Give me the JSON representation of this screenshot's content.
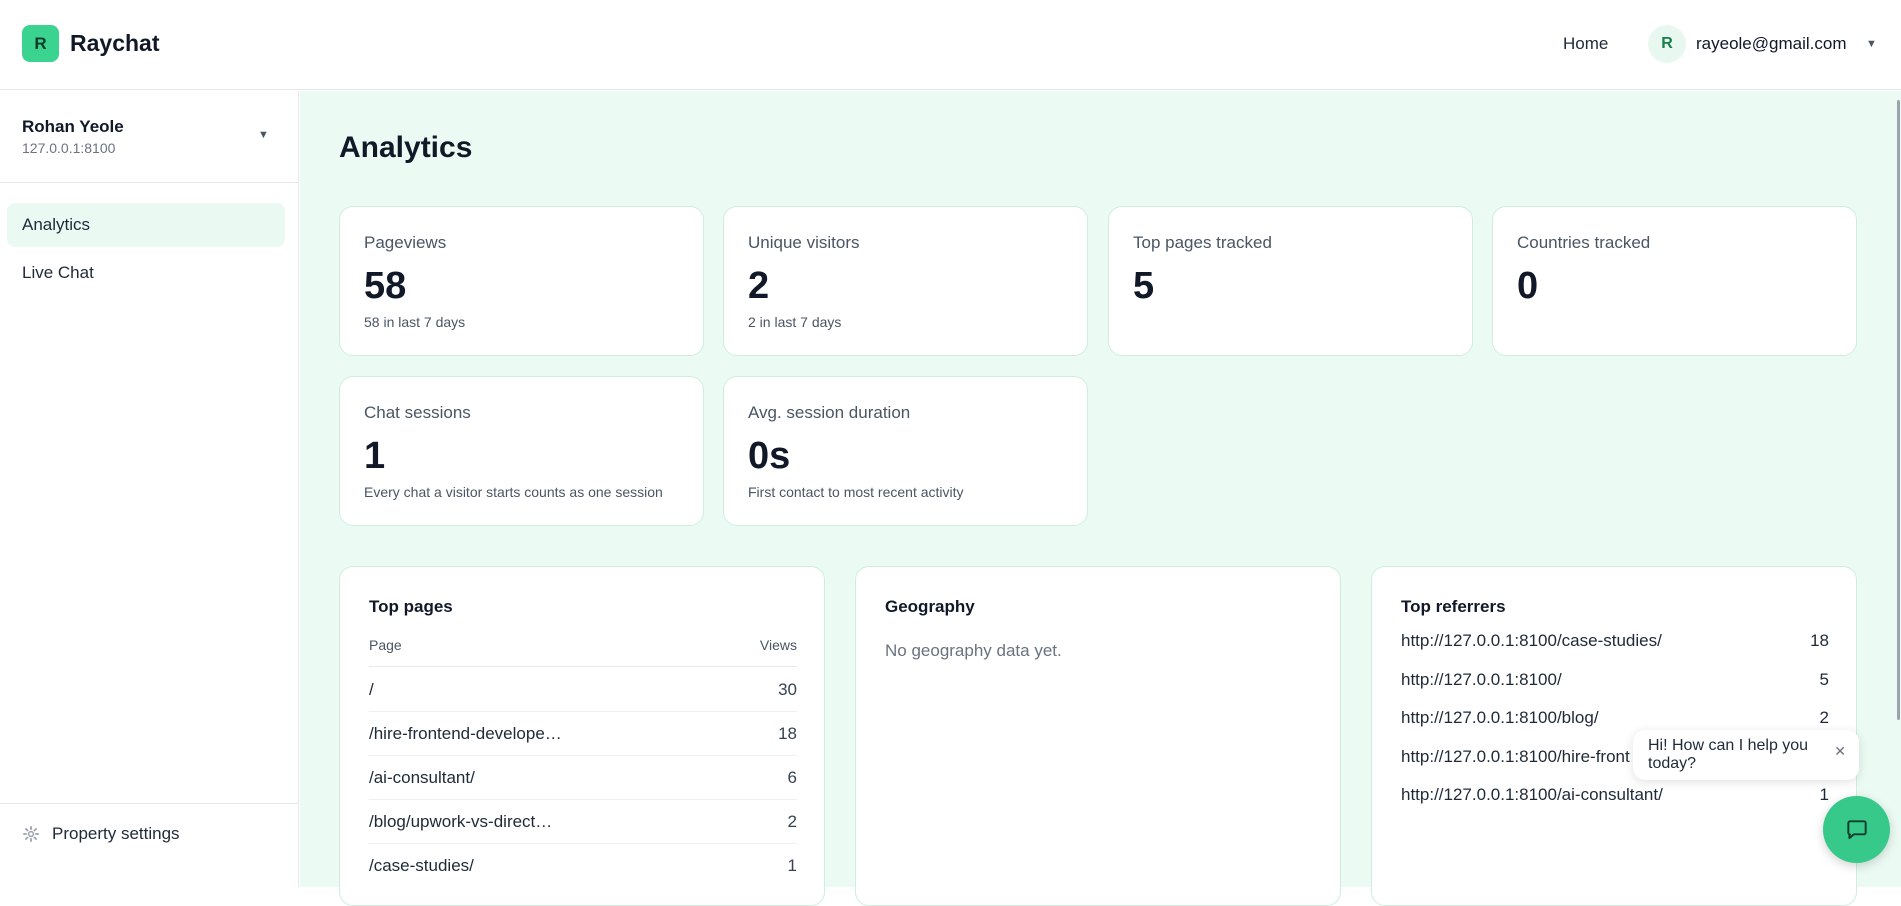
{
  "header": {
    "logo_letter": "R",
    "brand": "Raychat",
    "nav_home": "Home",
    "user_initial": "R",
    "user_email": "rayeole@gmail.com"
  },
  "sidebar": {
    "property_name": "Rohan Yeole",
    "property_host": "127.0.0.1:8100",
    "items": [
      {
        "label": "Analytics",
        "active": true
      },
      {
        "label": "Live Chat",
        "active": false
      }
    ],
    "settings_label": "Property settings"
  },
  "page": {
    "title": "Analytics"
  },
  "stats": [
    {
      "label": "Pageviews",
      "value": "58",
      "sub": "58 in last 7 days"
    },
    {
      "label": "Unique visitors",
      "value": "2",
      "sub": "2 in last 7 days"
    },
    {
      "label": "Top pages tracked",
      "value": "5",
      "sub": ""
    },
    {
      "label": "Countries tracked",
      "value": "0",
      "sub": ""
    },
    {
      "label": "Chat sessions",
      "value": "1",
      "sub": "Every chat a visitor starts counts as one session"
    },
    {
      "label": "Avg. session duration",
      "value": "0s",
      "sub": "First contact to most recent activity"
    }
  ],
  "top_pages": {
    "title": "Top pages",
    "col_page": "Page",
    "col_views": "Views",
    "rows": [
      {
        "page": "/",
        "views": "30"
      },
      {
        "page": "/hire-frontend-develope…",
        "views": "18"
      },
      {
        "page": "/ai-consultant/",
        "views": "6"
      },
      {
        "page": "/blog/upwork-vs-direct…",
        "views": "2"
      },
      {
        "page": "/case-studies/",
        "views": "1"
      }
    ]
  },
  "geography": {
    "title": "Geography",
    "empty": "No geography data yet."
  },
  "referrers": {
    "title": "Top referrers",
    "rows": [
      {
        "url": "http://127.0.0.1:8100/case-studies/",
        "count": "18"
      },
      {
        "url": "http://127.0.0.1:8100/",
        "count": "5"
      },
      {
        "url": "http://127.0.0.1:8100/blog/",
        "count": "2"
      },
      {
        "url": "http://127.0.0.1:8100/hire-front",
        "count": ""
      },
      {
        "url": "http://127.0.0.1:8100/ai-consultant/",
        "count": "1"
      }
    ]
  },
  "chat_widget": {
    "bubble_text": "Hi! How can I help you today?",
    "close_glyph": "✕"
  },
  "colors": {
    "accent": "#3ad38f",
    "main_bg": "#ebfbf3",
    "active_item_bg": "#eafaf2"
  }
}
